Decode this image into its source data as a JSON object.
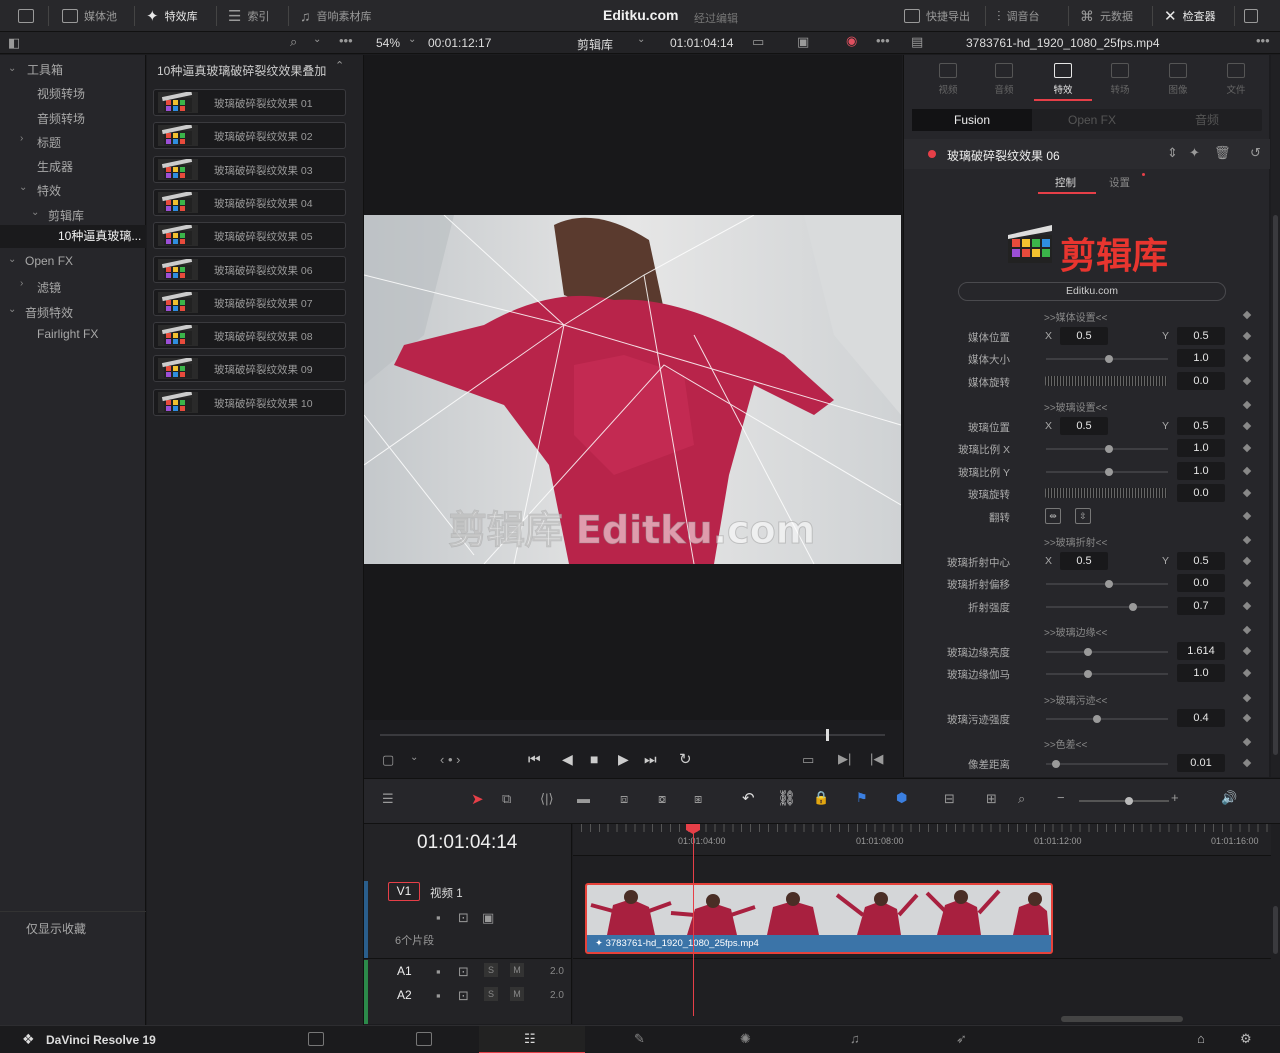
{
  "topbar": {
    "items": [
      "媒体池",
      "特效库",
      "索引",
      "音响素材库"
    ],
    "title": "Editku.com",
    "subtitle": "经过编辑",
    "right_items": [
      "快捷导出",
      "调音台",
      "元数据",
      "检查器"
    ]
  },
  "viewer": {
    "zoom": "54%",
    "timecode_left": "00:01:12:17",
    "bin": "剪辑库",
    "timecode_right": "01:01:04:14",
    "clip_name": "3783761-hd_1920_1080_25fps.mp4"
  },
  "left_tree": {
    "items": [
      "工具箱",
      "视频转场",
      "音频转场",
      "标题",
      "生成器",
      "特效",
      "剪辑库",
      "10种逼真玻璃...",
      "Open FX",
      "滤镜",
      "音频特效",
      "Fairlight FX"
    ],
    "favorites": "仅显示收藏"
  },
  "fx_list": {
    "header": "10种逼真玻璃破碎裂纹效果叠加",
    "items": [
      "玻璃破碎裂纹效果 01",
      "玻璃破碎裂纹效果 02",
      "玻璃破碎裂纹效果 03",
      "玻璃破碎裂纹效果 04",
      "玻璃破碎裂纹效果 05",
      "玻璃破碎裂纹效果 06",
      "玻璃破碎裂纹效果 07",
      "玻璃破碎裂纹效果 08",
      "玻璃破碎裂纹效果 09",
      "玻璃破碎裂纹效果 10"
    ]
  },
  "video": {
    "watermark": "剪辑库 Editku.com"
  },
  "inspector": {
    "tabs": [
      "视频",
      "音频",
      "特效",
      "转场",
      "图像",
      "文件"
    ],
    "subtabs": [
      "Fusion",
      "Open FX",
      "音频"
    ],
    "effect_name": "玻璃破碎裂纹效果 06",
    "ctrl_tabs": [
      "控制",
      "设置"
    ],
    "logo_text": "剪辑库",
    "site": "Editku.com",
    "sections": {
      "media": ">>媒体设置<<",
      "glass": ">>玻璃设置<<",
      "refract": ">>玻璃折射<<",
      "edge": ">>玻璃边缘<<",
      "stain": ">>玻璃污迹<<",
      "chroma": ">>色差<<"
    },
    "params": {
      "media_pos": {
        "label": "媒体位置",
        "x": "0.5",
        "y": "0.5"
      },
      "media_size": {
        "label": "媒体大小",
        "value": "1.0"
      },
      "media_rot": {
        "label": "媒体旋转",
        "value": "0.0"
      },
      "glass_pos": {
        "label": "玻璃位置",
        "x": "0.5",
        "y": "0.5"
      },
      "glass_sx": {
        "label": "玻璃比例 X",
        "value": "1.0"
      },
      "glass_sy": {
        "label": "玻璃比例 Y",
        "value": "1.0"
      },
      "glass_rot": {
        "label": "玻璃旋转",
        "value": "0.0"
      },
      "flip": {
        "label": "翻转"
      },
      "refract_center": {
        "label": "玻璃折射中心",
        "x": "0.5",
        "y": "0.5"
      },
      "refract_offset": {
        "label": "玻璃折射偏移",
        "value": "0.0"
      },
      "refract_strength": {
        "label": "折射强度",
        "value": "0.7"
      },
      "edge_bright": {
        "label": "玻璃边缘亮度",
        "value": "1.614"
      },
      "edge_gamma": {
        "label": "玻璃边缘伽马",
        "value": "1.0"
      },
      "stain_strength": {
        "label": "玻璃污迹强度",
        "value": "0.4"
      },
      "chroma_dist": {
        "label": "像差距离",
        "value": "0.01"
      }
    },
    "axis_x": "X",
    "axis_y": "Y"
  },
  "timeline": {
    "timecode": "01:01:04:14",
    "ruler": [
      "01:01:04:00",
      "01:01:08:00",
      "01:01:12:00",
      "01:01:16:00"
    ],
    "track_v1": "V1",
    "track_v1_name": "视频 1",
    "clips_count": "6个片段",
    "track_a1": "A1",
    "track_a2": "A2",
    "audio_level": "2.0",
    "solo": "S",
    "mute": "M",
    "clip_name": "3783761-hd_1920_1080_25fps.mp4"
  },
  "bottom": {
    "app": "DaVinci Resolve 19"
  }
}
